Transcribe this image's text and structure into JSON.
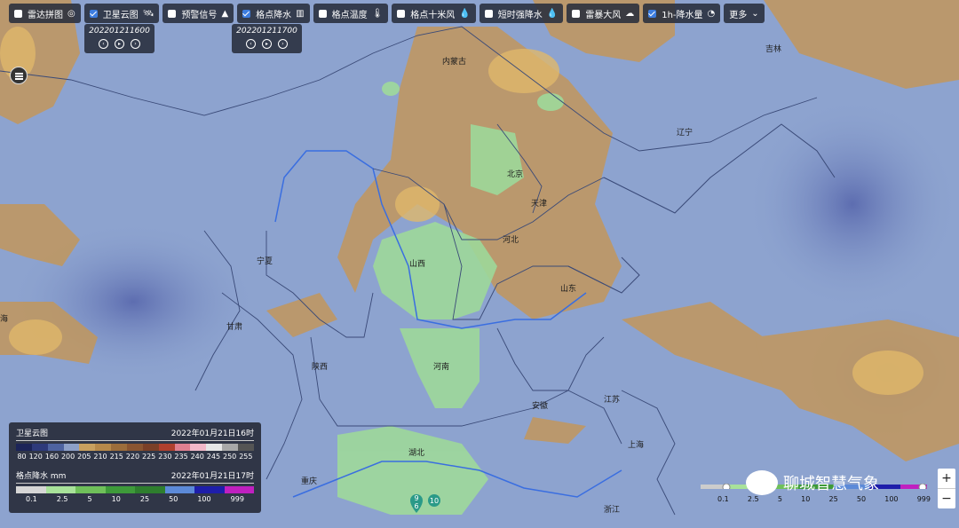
{
  "toolbar": {
    "items": [
      {
        "label": "雷达拼图",
        "checked": false,
        "icon": "radar-icon"
      },
      {
        "label": "卫星云图",
        "checked": true,
        "icon": "satellite-icon"
      },
      {
        "label": "预警信号",
        "checked": false,
        "icon": "warning-icon"
      },
      {
        "label": "格点降水",
        "checked": true,
        "icon": "precip-chart-icon"
      },
      {
        "label": "格点温度",
        "checked": false,
        "icon": "thermometer-icon"
      },
      {
        "label": "格点十米风",
        "checked": false,
        "icon": "wind-icon"
      },
      {
        "label": "短时强降水",
        "checked": false,
        "icon": "heavy-rain-icon"
      },
      {
        "label": "雷暴大风",
        "checked": false,
        "icon": "thunder-wind-icon"
      },
      {
        "label": "1h-降水量",
        "checked": true,
        "icon": "clock-rain-icon"
      }
    ],
    "more_label": "更多"
  },
  "satellite_time": "202201211600",
  "precip_time": "202201211700",
  "provinces": [
    "内蒙古",
    "吉林",
    "辽宁",
    "北京",
    "天津",
    "河北",
    "宁夏",
    "山西",
    "山东",
    "甘肃",
    "陕西",
    "河南",
    "江苏",
    "安徽",
    "上海",
    "湖北",
    "重庆",
    "浙江",
    "海"
  ],
  "legend_satellite": {
    "title": "卫星云图",
    "time": "2022年01月21日16时",
    "ticks": [
      "80",
      "120",
      "160",
      "200",
      "205",
      "210",
      "215",
      "220",
      "225",
      "230",
      "235",
      "240",
      "245",
      "250",
      "255"
    ],
    "colors": [
      "#1c2458",
      "#2e3a7a",
      "#4e63a0",
      "#8da0c8",
      "#c9a05e",
      "#b7894a",
      "#9c6d3b",
      "#8a5531",
      "#7a4028",
      "#b0402e",
      "#e08090",
      "#f2b8c8",
      "#e6e6e6",
      "#a8a8a8",
      "#555555"
    ]
  },
  "legend_precip": {
    "title": "格点降水 mm",
    "time": "2022年01月21日17时",
    "ticks": [
      "0.1",
      "2.5",
      "5",
      "10",
      "25",
      "50",
      "100",
      "999"
    ],
    "colors": [
      "#d6d6d6",
      "#a8e29a",
      "#6fc05a",
      "#3e9a3a",
      "#2e7e2e",
      "#5c8ad8",
      "#1e1eaa",
      "#c020c0"
    ]
  },
  "slider_ticks": [
    "0.1",
    "2.5",
    "5",
    "10",
    "25",
    "50",
    "100",
    "999"
  ],
  "markers": [
    "9",
    "6",
    "10"
  ],
  "watermark": "聊城智慧气象",
  "zoom": {
    "in": "+",
    "out": "−"
  },
  "colors": {
    "land": "#8da3cf",
    "cloud_warm": "#c2975c",
    "precip": "#9ed99a",
    "border": "#2a3a6a",
    "river": "#3a6ee0"
  }
}
